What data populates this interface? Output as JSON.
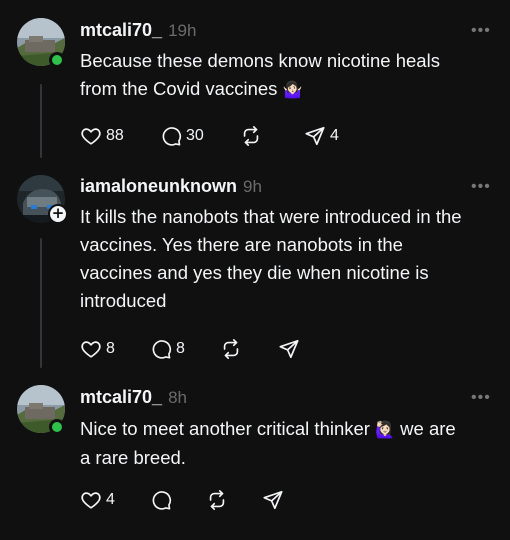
{
  "posts": [
    {
      "username": "mtcali70_",
      "time": "19h",
      "text_lines": [
        "Because these demons know nicotine heals",
        "from the Covid vaccines"
      ],
      "emoji": "🤷🏻‍♀️",
      "likes": "88",
      "replies": "30",
      "reposts": "",
      "shares": "4",
      "more": "•••"
    },
    {
      "username": "iamaloneunknown",
      "time": "9h",
      "text_lines": [
        "It kills the nanobots that were introduced in the",
        "vaccines. Yes there are nanobots in the",
        "vaccines and yes they die when nicotine is",
        "introduced"
      ],
      "likes": "8",
      "replies": "8",
      "reposts": "",
      "shares": "",
      "more": "•••",
      "follow_badge": "+"
    },
    {
      "username": "mtcali70_",
      "time": "8h",
      "text_lines": [
        "Nice to meet another critical thinker",
        "a rare breed."
      ],
      "emoji": "🙋🏻‍♀️",
      "text_after_emoji": "we are",
      "likes": "4",
      "replies": "",
      "reposts": "",
      "shares": "",
      "more": "•••"
    }
  ],
  "colors": {
    "background": "#101010",
    "text_primary": "#f3f5f7",
    "text_secondary": "#6b6b6b",
    "online_green": "#2fc24a",
    "thread_line": "#333638"
  },
  "icons": {
    "like": "heart-icon",
    "reply": "comment-bubble-icon",
    "repost": "repost-arrows-icon",
    "share": "paper-plane-icon",
    "more": "ellipsis-icon",
    "follow": "plus-icon",
    "online": "online-status-dot"
  }
}
